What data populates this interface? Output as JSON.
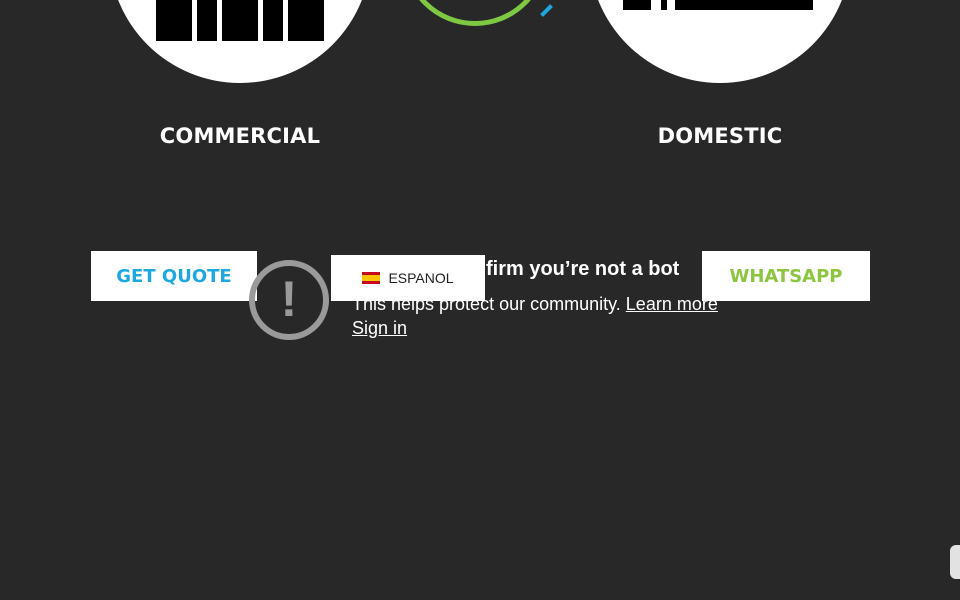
{
  "sections": {
    "commercial": {
      "title": "COMMERCIAL"
    },
    "domestic": {
      "title": "DOMESTIC"
    }
  },
  "buttons": {
    "get_quote": "GET QUOTE",
    "whatsapp": "WHATSAPP"
  },
  "captcha": {
    "title": "firm you’re not a bot",
    "message": "This helps protect our community.",
    "learn_more": "Learn more",
    "sign_in": "Sign in",
    "icon": "exclamation-icon"
  },
  "language": {
    "label": "ESPANOL",
    "flag": "spain-flag-icon"
  },
  "colors": {
    "background": "#282828",
    "quote": "#1fa8df",
    "whatsapp": "#8cc63f",
    "ring": "#7ec843"
  }
}
